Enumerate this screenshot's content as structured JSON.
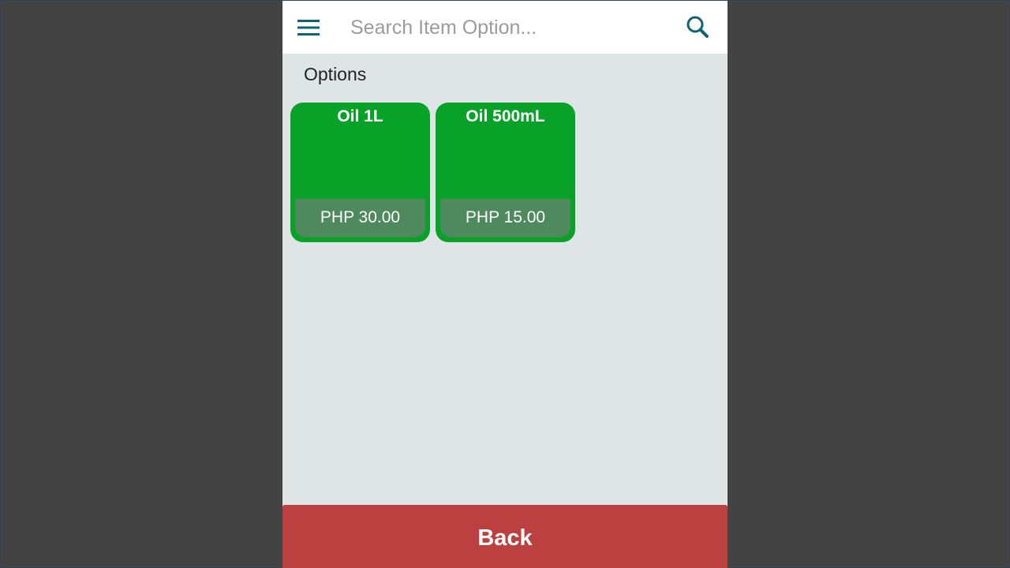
{
  "search": {
    "placeholder": "Search Item Option...",
    "value": ""
  },
  "icons": {
    "menu": "hamburger-menu-icon",
    "search": "magnifier-search-icon"
  },
  "section_title": "Options",
  "options": [
    {
      "name": "Oil 1L",
      "price": "PHP 30.00"
    },
    {
      "name": "Oil 500mL",
      "price": "PHP 15.00"
    }
  ],
  "back_button": {
    "label": "Back"
  },
  "colors": {
    "accent_teal": "#0f6379",
    "option_green": "#09a229",
    "option_price_bg": "#4e8a5e",
    "back_red": "#bd4040",
    "app_background": "#dfe4e6",
    "outer_background": "#434343"
  }
}
